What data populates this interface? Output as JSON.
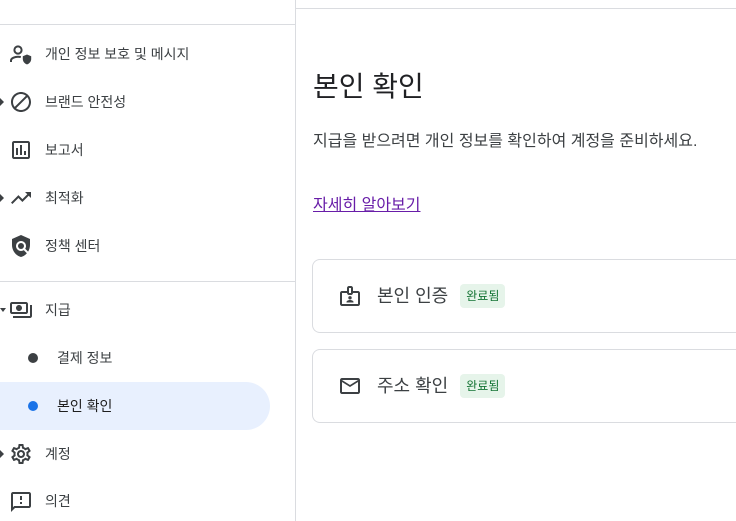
{
  "sidebar": {
    "items": [
      {
        "label": "개인 정보 보호 및 메시지",
        "icon": "privacy-icon"
      },
      {
        "label": "브랜드 안전성",
        "icon": "block-icon",
        "expandable": true,
        "expanded": false
      },
      {
        "label": "보고서",
        "icon": "bar-chart-icon"
      },
      {
        "label": "최적화",
        "icon": "trending-up-icon",
        "expandable": true,
        "expanded": false
      },
      {
        "label": "정책 센터",
        "icon": "policy-icon"
      },
      {
        "label": "지급",
        "icon": "payments-icon",
        "expandable": true,
        "expanded": true,
        "children": [
          {
            "label": "결제 정보",
            "selected": false
          },
          {
            "label": "본인 확인",
            "selected": true
          }
        ]
      },
      {
        "label": "계정",
        "icon": "settings-icon",
        "expandable": true,
        "expanded": false
      },
      {
        "label": "의견",
        "icon": "feedback-icon"
      }
    ]
  },
  "main": {
    "title": "본인 확인",
    "description": "지급을 받으려면 개인 정보를 확인하여 계정을 준비하세요.",
    "learn_more_link": "자세히 알아보기",
    "verification_items": [
      {
        "label": "본인 인증",
        "status": "완료됨",
        "icon": "badge-icon"
      },
      {
        "label": "주소 확인",
        "status": "완료됨",
        "icon": "mail-icon"
      }
    ]
  },
  "colors": {
    "text": "#3c4043",
    "title": "#202124",
    "divider": "#dadce0",
    "selected_bg": "#e8f0fe",
    "accent": "#1a73e8",
    "link": "#681da8",
    "status_bg": "#e6f4ea",
    "status_text": "#137333"
  }
}
